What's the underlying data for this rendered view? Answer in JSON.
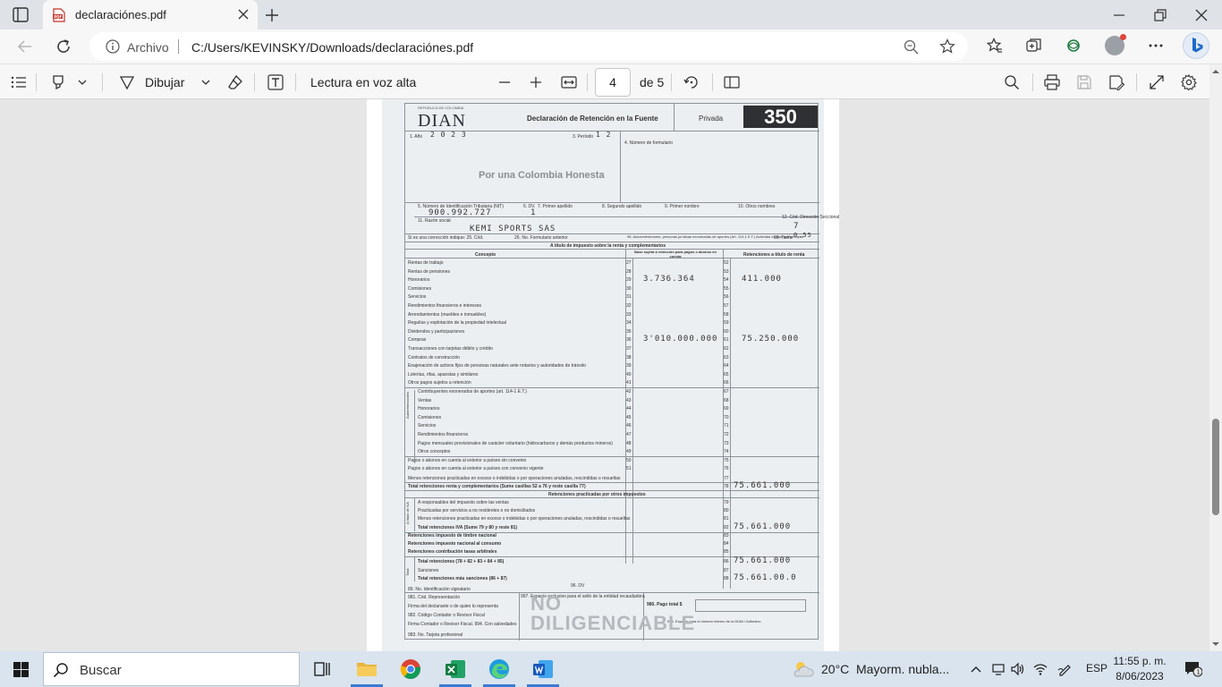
{
  "browser": {
    "tab_title": "declaraciónes.pdf",
    "address_label": "Archivo",
    "url": "C:/Users/KEVINSKY/Downloads/declaraciónes.pdf"
  },
  "pdf_toolbar": {
    "draw_label": "Dibujar",
    "read_aloud_label": "Lectura en voz alta",
    "page_current": "4",
    "page_total": "de 5"
  },
  "document": {
    "header": {
      "org_label": "REPÚBLICA DE COLOMBIA",
      "logo_text": "DIAN",
      "title": "Declaración de Retención en la Fuente",
      "privacy": "Privada",
      "form_number": "350",
      "slogan": "Por una Colombia Honesta"
    },
    "fields": {
      "anio_label": "1. Año",
      "anio_value": "2 0 2 3",
      "periodo_label": "3. Período",
      "periodo_value": "1 2",
      "num_formulario_label": "4. Número de formulario",
      "nit_label": "5. Número de Identificación Tributaria (NIT)",
      "dv_label": "6. DV.",
      "primer_apellido_label": "7. Primer apellido",
      "segundo_apellido_label": "8. Segundo apellido",
      "primer_nombre_label": "9. Primer nombre",
      "otros_nombres_label": "10. Otros nombres",
      "nit_value": "900.992.727",
      "dv_value": "1",
      "razon_social_label": "11. Razón social",
      "razon_social_value": "KEMI SPORTS SAS",
      "direccion_seccional_label": "12. Cód. Dirección Seccional",
      "direccion_seccional_value": "7",
      "correccion_label": "Si es una corrección indique:  25. Cód.",
      "formulario_anterior_label": "26. No. Formulario anterior",
      "autorretenedor_label": "98. Autorretenedores, personas jurídicas exoneradas de aportes (Art. 114-1 E.T.) Actividad económica principal",
      "tarifa_label": "99. Tarifa",
      "tarifa_value": "0.55"
    },
    "table": {
      "section_title": "A título de impuesto sobre la renta y complementarios",
      "col_concepto": "Concepto",
      "col_base": "Base sujeta a retención para pagos o abonos en cuenta",
      "col_retenciones": "Retenciones a título de renta",
      "rows": [
        {
          "label": "Rentas de trabajo",
          "code_a": "27",
          "code_b": "52",
          "base": "",
          "ret": ""
        },
        {
          "label": "Rentas de pensiones",
          "code_a": "28",
          "code_b": "53",
          "base": "",
          "ret": ""
        },
        {
          "label": "Honorarios",
          "code_a": "29",
          "code_b": "54",
          "base": "3.736.364",
          "ret": "411.000"
        },
        {
          "label": "Comisiones",
          "code_a": "30",
          "code_b": "55",
          "base": "",
          "ret": ""
        },
        {
          "label": "Servicios",
          "code_a": "31",
          "code_b": "56",
          "base": "",
          "ret": ""
        },
        {
          "label": "Rendimientos financieros e intereses",
          "code_a": "32",
          "code_b": "57",
          "base": "",
          "ret": ""
        },
        {
          "label": "Arrendamientos (muebles e inmuebles)",
          "code_a": "33",
          "code_b": "58",
          "base": "",
          "ret": ""
        },
        {
          "label": "Regalías y explotación de la propiedad intelectual",
          "code_a": "34",
          "code_b": "59",
          "base": "",
          "ret": ""
        },
        {
          "label": "Dividendos y participaciones",
          "code_a": "35",
          "code_b": "60",
          "base": "",
          "ret": ""
        },
        {
          "label": "Compras",
          "code_a": "36",
          "code_b": "61",
          "base": "3'010.000.000",
          "ret": "75.250.000"
        },
        {
          "label": "Transacciones con tarjetas débito y crédito",
          "code_a": "37",
          "code_b": "62",
          "base": "",
          "ret": ""
        },
        {
          "label": "Contratos de construcción",
          "code_a": "38",
          "code_b": "63",
          "base": "",
          "ret": ""
        },
        {
          "label": "Enajenación de activos fijos de personas naturales ante notarios y autoridades de tránsito",
          "code_a": "39",
          "code_b": "64",
          "base": "",
          "ret": ""
        },
        {
          "label": "Loterías, rifas, apuestas y similares",
          "code_a": "40",
          "code_b": "65",
          "base": "",
          "ret": ""
        },
        {
          "label": "Otros pagos sujetos a retención",
          "code_a": "41",
          "code_b": "66",
          "base": "",
          "ret": ""
        },
        {
          "label": "Contribuyentes exonerados de aportes (art. 114-1 E.T.)",
          "code_a": "42",
          "code_b": "67",
          "base": "",
          "ret": ""
        },
        {
          "label": "Ventas",
          "code_a": "43",
          "code_b": "68",
          "base": "",
          "ret": ""
        },
        {
          "label": "Honorarios",
          "code_a": "44",
          "code_b": "69",
          "base": "",
          "ret": ""
        },
        {
          "label": "Comisiones",
          "code_a": "45",
          "code_b": "70",
          "base": "",
          "ret": ""
        },
        {
          "label": "Servicios",
          "code_a": "46",
          "code_b": "71",
          "base": "",
          "ret": ""
        },
        {
          "label": "Rendimientos financieros",
          "code_a": "47",
          "code_b": "72",
          "base": "",
          "ret": ""
        },
        {
          "label": "Pagos mensuales provisionales de carácter voluntario (hidrocarburos y demás productos mineros)",
          "code_a": "48",
          "code_b": "73",
          "base": "",
          "ret": ""
        },
        {
          "label": "Otros conceptos",
          "code_a": "49",
          "code_b": "74",
          "base": "",
          "ret": ""
        },
        {
          "label": "Pagos o abonos en cuenta al exterior a países sin convenio",
          "code_a": "50",
          "code_b": "75",
          "base": "",
          "ret": ""
        },
        {
          "label": "Pagos o abonos en cuenta al exterior a países con convenio vigente",
          "code_a": "51",
          "code_b": "76",
          "base": "",
          "ret": ""
        }
      ],
      "autorretenciones_label": "Autorretenciones",
      "menos_retenciones_label": "Menos retenciones practicadas en exceso o indebidas o por operaciones anuladas, rescindidas o resueltas",
      "menos_code": "77",
      "total_renta_label": "Total retenciones renta y complementarios (Sume casillas 52 a 76 y reste casilla 77)",
      "total_renta_code": "78",
      "total_renta_value": "75.661.000"
    },
    "otros": {
      "section_title": "Retenciones practicadas por otros impuestos",
      "a_titulo_iva_label": "A título de IVA",
      "rows": [
        {
          "label": "A responsables del impuesto sobre las ventas",
          "code": "79",
          "value": ""
        },
        {
          "label": "Practicadas por servicios a no residentes o no domiciliados",
          "code": "80",
          "value": ""
        },
        {
          "label": "Menos retenciones practicadas en exceso o indebidas o por operaciones anuladas, rescindidas o resueltas",
          "code": "81",
          "value": ""
        },
        {
          "label": "Total retenciones IVA (Sume 79 y 80 y reste 81)",
          "code": "82",
          "value": "75.661.000"
        },
        {
          "label": "Retenciones impuesto de timbre nacional",
          "code": "83",
          "value": ""
        },
        {
          "label": "Retenciones impuesto nacional al consumo",
          "code": "84",
          "value": ""
        },
        {
          "label": "Retenciones contribución tasas arbitrales",
          "code": "85",
          "value": ""
        }
      ],
      "total_label": "Total",
      "total_rows": [
        {
          "label": "Total retenciones (78 + 82 + 83 + 84 + 85)",
          "code": "86",
          "value": "75.661.000"
        },
        {
          "label": "Sanciones",
          "code": "87",
          "value": ""
        },
        {
          "label": "Total retenciones más sanciones (86 + 87)",
          "code": "88",
          "value": "75.661.00.0"
        }
      ]
    },
    "footer": {
      "dv_label": "96. DV",
      "id_firmante": "89. No. Identificación signatario",
      "cod_representacion": "981. Cód. Representación",
      "firma_declarante": "Firma del declarante o de quien lo representa",
      "cod_contador": "982. Código Contador o Revisor Fiscal",
      "firma_contador": "Firma Contador o Revisor Fiscal.  994. Con salvedades",
      "tarjeta_profesional": "983. No. Tarjeta profesional",
      "espacio_recaudadora": "997. Espacio exclusivo para el sello de la entidad recaudadora",
      "pago_total": "980. Pago total $",
      "espacio_dian": "996. Espacio para el número interno de la DIAN / Adhesivo",
      "stamp_line1": "NO",
      "stamp_line2": "DILIGENCIABLE"
    }
  },
  "taskbar": {
    "search_placeholder": "Buscar",
    "temperature": "20°C",
    "weather": "Mayorm. nubla...",
    "language": "ESP",
    "time": "11:55 p. m.",
    "date": "8/06/2023",
    "notification_count": "1"
  },
  "colors": {
    "accent": "#0067c0",
    "taskbar": "#d9e4ef",
    "excel": "#1d6f42",
    "word": "#2b579a",
    "edge": "#1f9bde",
    "pdf_red": "#c4312b"
  }
}
